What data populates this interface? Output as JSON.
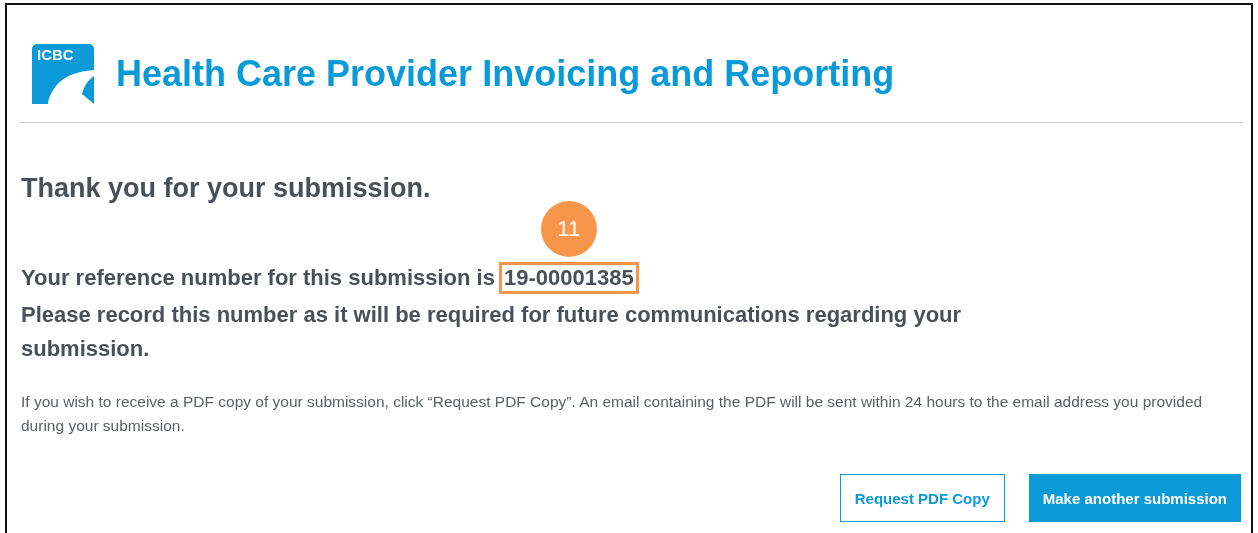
{
  "header": {
    "logo_text": "ICBC",
    "title": "Health Care Provider Invoicing and Reporting"
  },
  "confirmation": {
    "heading": "Thank you for your submission.",
    "reference_label": "Your reference number for this submission is",
    "reference_number": "19-00001385",
    "record_note": "Please record this number as it will be required for future communications regarding your submission.",
    "annotation": {
      "number": "11",
      "color": "#f7964a"
    }
  },
  "pdf_info": "If you wish to receive a PDF copy of your submission, click “Request PDF Copy”. An email containing the PDF will be sent within 24 hours to the email address you provided during your submission.",
  "buttons": [
    {
      "label": "Request PDF Copy",
      "kind": "secondary"
    },
    {
      "label": "Make another submission",
      "kind": "primary"
    }
  ]
}
